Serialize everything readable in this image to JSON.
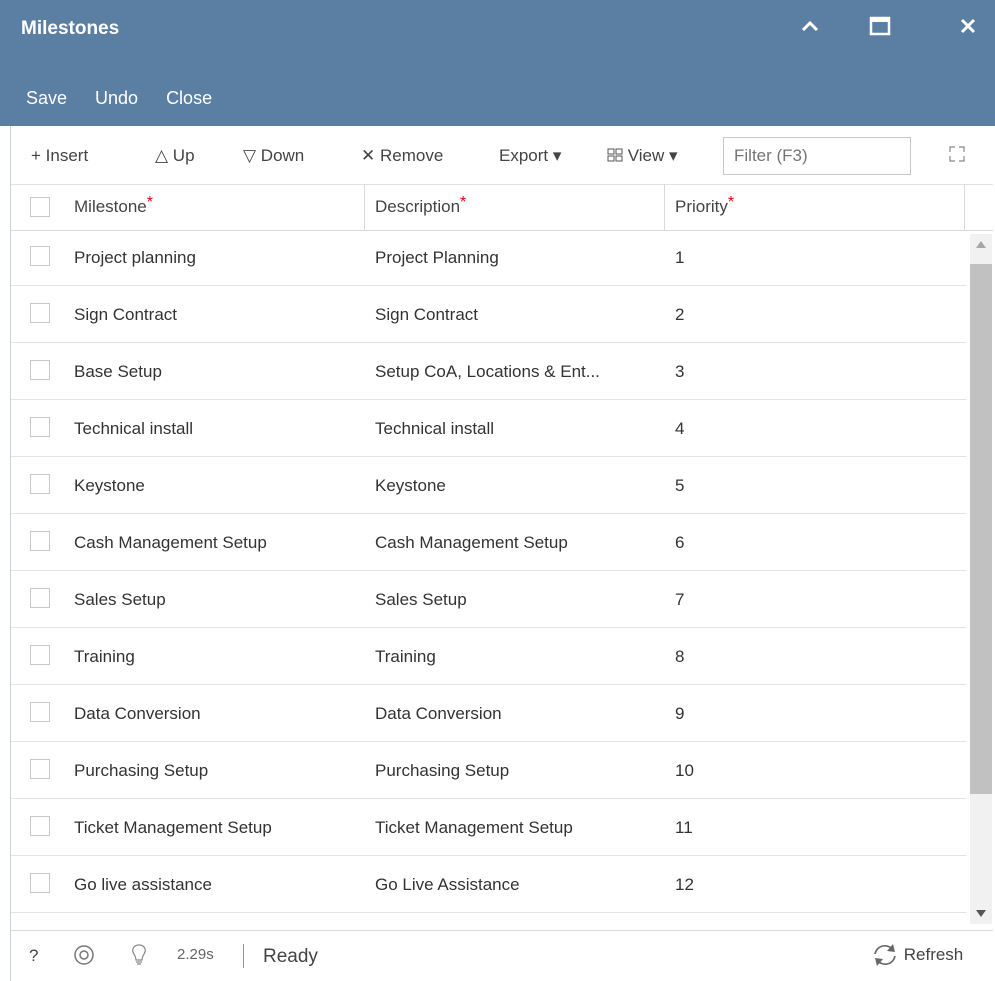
{
  "window": {
    "title": "Milestones",
    "controls": {
      "collapse": "^",
      "maximize": "□",
      "close": "✕"
    }
  },
  "menu": {
    "save": "Save",
    "undo": "Undo",
    "close": "Close"
  },
  "toolbar": {
    "insert": "+ Insert",
    "up": "△ Up",
    "down": "▽ Down",
    "remove": "✕ Remove",
    "export": "Export ▾",
    "view": "View ▾",
    "filter_placeholder": "Filter (F3)"
  },
  "columns": [
    "Milestone",
    "Description",
    "Priority"
  ],
  "rows": [
    {
      "milestone": "Project planning",
      "description": "Project Planning",
      "priority": "1"
    },
    {
      "milestone": "Sign Contract",
      "description": "Sign Contract",
      "priority": "2"
    },
    {
      "milestone": "Base Setup",
      "description": "Setup CoA, Locations & Ent...",
      "priority": "3"
    },
    {
      "milestone": "Technical install",
      "description": "Technical install",
      "priority": "4"
    },
    {
      "milestone": "Keystone",
      "description": "Keystone",
      "priority": "5"
    },
    {
      "milestone": "Cash Management Setup",
      "description": "Cash Management Setup",
      "priority": "6"
    },
    {
      "milestone": "Sales Setup",
      "description": "Sales Setup",
      "priority": "7"
    },
    {
      "milestone": "Training",
      "description": "Training",
      "priority": "8"
    },
    {
      "milestone": "Data Conversion",
      "description": "Data Conversion",
      "priority": "9"
    },
    {
      "milestone": "Purchasing Setup",
      "description": "Purchasing Setup",
      "priority": "10"
    },
    {
      "milestone": "Ticket Management Setup",
      "description": "Ticket Management Setup",
      "priority": "11"
    },
    {
      "milestone": "Go live assistance",
      "description": "Go Live Assistance",
      "priority": "12"
    }
  ],
  "status": {
    "help": "?",
    "timing": "2.29s",
    "state": "Ready",
    "refresh": "Refresh"
  },
  "colors": {
    "titlebar": "#5b7fa3",
    "required": "#e00000"
  }
}
